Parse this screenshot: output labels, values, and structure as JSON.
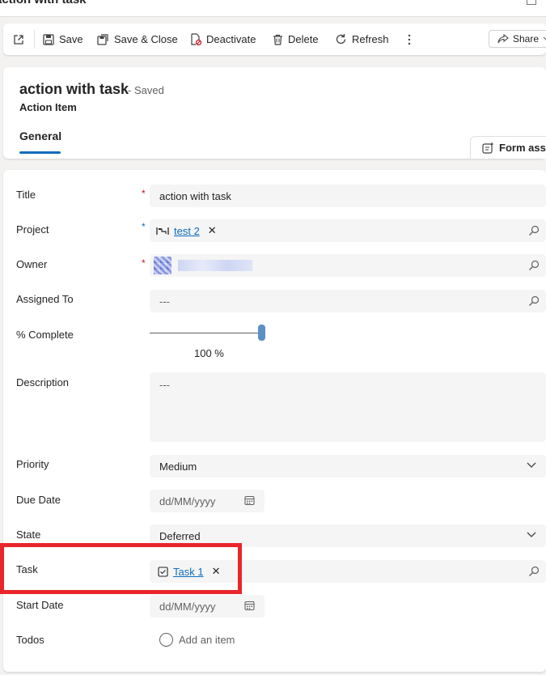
{
  "window": {
    "title": "action with task"
  },
  "toolbar": {
    "save": "Save",
    "save_close": "Save & Close",
    "deactivate": "Deactivate",
    "delete": "Delete",
    "refresh": "Refresh",
    "share": "Share"
  },
  "header": {
    "title": "action with task",
    "status": "- Saved",
    "entity": "Action Item",
    "tab": "General",
    "form_assist": "Form assis"
  },
  "form": {
    "title": {
      "label": "Title",
      "value": "action with task"
    },
    "project": {
      "label": "Project",
      "value": "test 2"
    },
    "owner": {
      "label": "Owner"
    },
    "assigned_to": {
      "label": "Assigned To",
      "value": "---"
    },
    "percent_complete": {
      "label": "% Complete",
      "value": "100 %",
      "fraction": 1.0
    },
    "description": {
      "label": "Description",
      "value": "---"
    },
    "priority": {
      "label": "Priority",
      "value": "Medium"
    },
    "due_date": {
      "label": "Due Date",
      "placeholder": "dd/MM/yyyy"
    },
    "state": {
      "label": "State",
      "value": "Deferred"
    },
    "task": {
      "label": "Task",
      "value": "Task 1"
    },
    "start_date": {
      "label": "Start Date",
      "placeholder": "dd/MM/yyyy"
    },
    "todos": {
      "label": "Todos",
      "add_item": "Add an item"
    }
  },
  "colors": {
    "accent": "#0f6cbd",
    "required": "#c50f1f",
    "highlight": "#e8262b"
  }
}
